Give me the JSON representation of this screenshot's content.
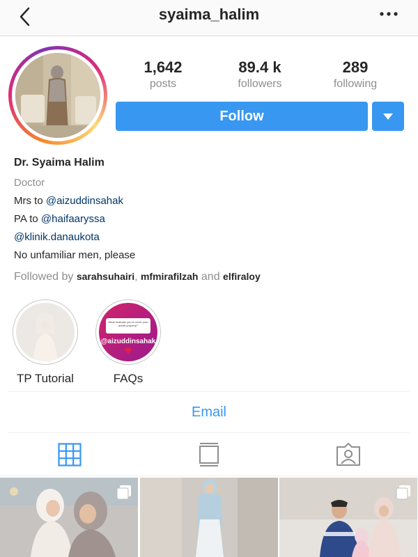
{
  "header": {
    "username": "syaima_halim",
    "back_icon": "chevron-left-icon",
    "more_icon": "more-horizontal-icon"
  },
  "stats": {
    "posts_count": "1,642",
    "posts_label": "posts",
    "followers_count": "89.4 k",
    "followers_label": "followers",
    "following_count": "289",
    "following_label": "following"
  },
  "actions": {
    "follow_label": "Follow",
    "dropdown_icon": "caret-down-icon",
    "accent_color": "#3897f0"
  },
  "bio": {
    "name": "Dr. Syaima Halim",
    "category": "Doctor",
    "line1_prefix": "Mrs to ",
    "line1_link": "@aizuddinsahak",
    "line2_prefix": "PA to ",
    "line2_link": "@haifaaryssa",
    "line3_link": "@klinik.danaukota",
    "line4": "No unfamiliar men, please"
  },
  "followed_by": {
    "prefix": "Followed by ",
    "user1": "sarahsuhairi",
    "sep": ", ",
    "user2": "mfmirafilzah",
    "and": " and ",
    "user3": "elfiraloy"
  },
  "highlights": [
    {
      "label": "TP Tutorial"
    },
    {
      "label": "FAQs",
      "story_question": "What motivate you to cover your aurah properly?",
      "story_tag": "@aizuddinsahak"
    }
  ],
  "contact": {
    "email_label": "Email"
  },
  "tabs": [
    {
      "icon": "grid-icon",
      "active": true
    },
    {
      "icon": "feed-icon",
      "active": false
    },
    {
      "icon": "tagged-icon",
      "active": false
    }
  ]
}
